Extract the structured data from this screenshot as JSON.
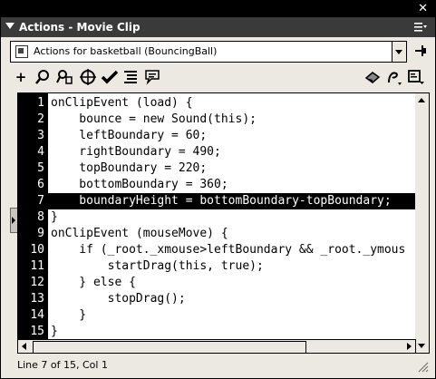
{
  "topbar": {
    "close_glyph": "✕"
  },
  "panel": {
    "title": "Actions - Movie Clip",
    "menu_icon": "panel-menu-icon"
  },
  "selector": {
    "value": "Actions for basketball (BouncingBall)",
    "icon": "movieclip-icon"
  },
  "toolbar": {
    "left": [
      "add-icon",
      "find-icon",
      "replace-icon",
      "target-icon",
      "check-syntax-icon",
      "auto-format-icon",
      "code-hint-icon"
    ],
    "right": [
      "reference-icon",
      "debug-options-icon",
      "view-options-icon"
    ]
  },
  "code": {
    "lines": [
      {
        "num": "1",
        "text": "onClipEvent (load) {"
      },
      {
        "num": "2",
        "text": "    bounce = new Sound(this);"
      },
      {
        "num": "3",
        "text": "    leftBoundary = 60;"
      },
      {
        "num": "4",
        "text": "    rightBoundary = 490;"
      },
      {
        "num": "5",
        "text": "    topBoundary = 220;"
      },
      {
        "num": "6",
        "text": "    bottomBoundary = 360;"
      },
      {
        "num": "7",
        "text": "    boundaryHeight = bottomBoundary-topBoundary;"
      },
      {
        "num": "8",
        "text": "}"
      },
      {
        "num": "9",
        "text": "onClipEvent (mouseMove) {"
      },
      {
        "num": "10",
        "text": "    if (_root._xmouse>leftBoundary && _root._ymous"
      },
      {
        "num": "11",
        "text": "        startDrag(this, true);"
      },
      {
        "num": "12",
        "text": "    } else {"
      },
      {
        "num": "13",
        "text": "        stopDrag();"
      },
      {
        "num": "14",
        "text": "    }"
      },
      {
        "num": "15",
        "text": "}"
      }
    ],
    "highlighted_line": 7
  },
  "status": {
    "text": "Line 7 of 15, Col 1"
  },
  "colors": {
    "gutter": "#000000",
    "titlebar": "#3a3a3a",
    "panel_bg": "#ebe9e1",
    "highlight": "#000000"
  }
}
